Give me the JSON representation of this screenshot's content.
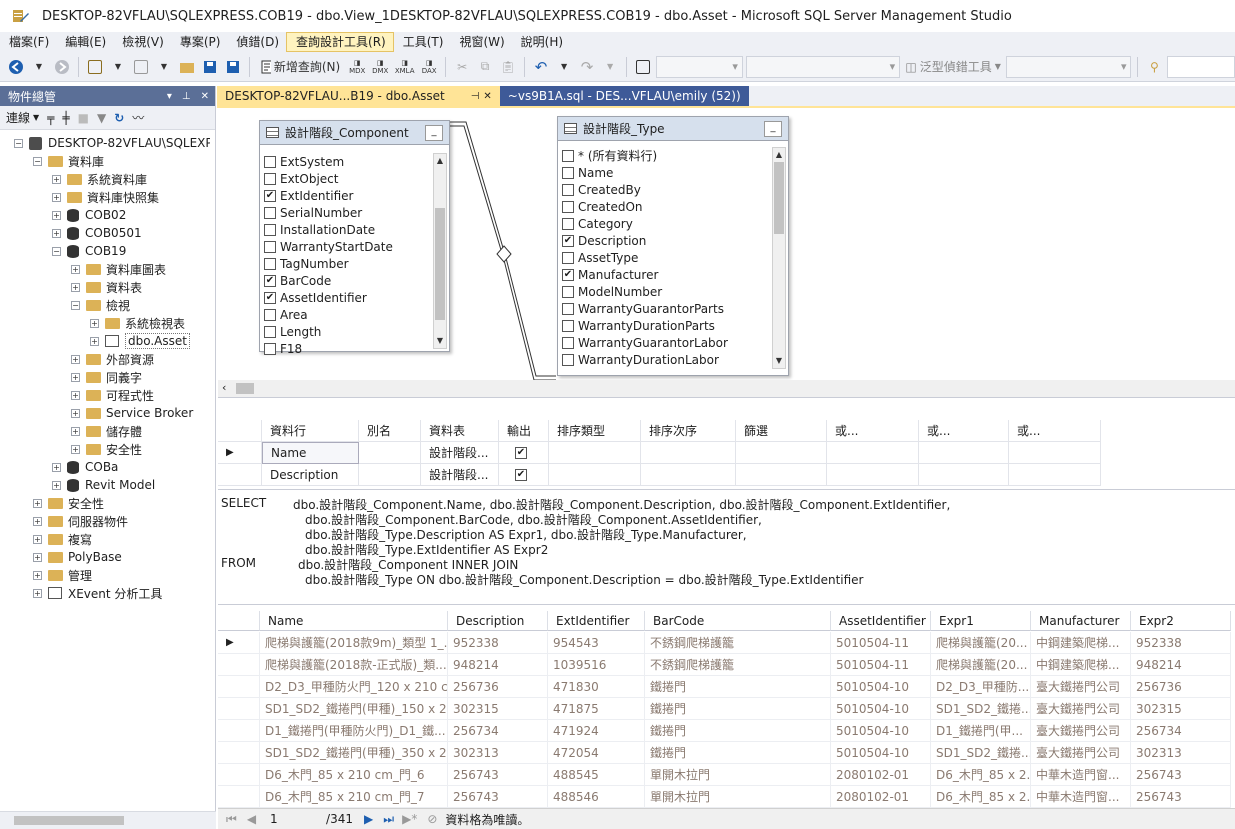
{
  "window": {
    "title": "DESKTOP-82VFLAU\\SQLEXPRESS.COB19 - dbo.View_1DESKTOP-82VFLAU\\SQLEXPRESS.COB19 - dbo.Asset - Microsoft SQL Server Management Studio"
  },
  "menu": [
    "檔案(F)",
    "編輯(E)",
    "檢視(V)",
    "專案(P)",
    "偵錯(D)",
    "查詢設計工具(R)",
    "工具(T)",
    "視窗(W)",
    "說明(H)"
  ],
  "toolbar": {
    "new_query": "新增查詢(N)",
    "mdx": "MDX",
    "dmx": "DMX",
    "xmla": "XMLA",
    "dax": "DAX",
    "generic_debugger": "泛型偵錯工具"
  },
  "object_explorer": {
    "title": "物件總管",
    "connect": "連線",
    "tree": [
      {
        "label": "DESKTOP-82VFLAU\\SQLEXPRESS",
        "type": "server",
        "level": 0,
        "expanded": true
      },
      {
        "label": "資料庫",
        "type": "folder",
        "level": 1,
        "expanded": true
      },
      {
        "label": "系統資料庫",
        "type": "folder",
        "level": 2,
        "expanded": false
      },
      {
        "label": "資料庫快照集",
        "type": "folder",
        "level": 2,
        "expanded": false
      },
      {
        "label": "COB02",
        "type": "db",
        "level": 2,
        "expanded": false
      },
      {
        "label": "COB0501",
        "type": "db",
        "level": 2,
        "expanded": false
      },
      {
        "label": "COB19",
        "type": "db",
        "level": 2,
        "expanded": true
      },
      {
        "label": "資料庫圖表",
        "type": "folder",
        "level": 3,
        "expanded": false
      },
      {
        "label": "資料表",
        "type": "folder",
        "level": 3,
        "expanded": false
      },
      {
        "label": "檢視",
        "type": "folder",
        "level": 3,
        "expanded": true
      },
      {
        "label": "系統檢視表",
        "type": "folder",
        "level": 4,
        "expanded": false
      },
      {
        "label": "dbo.Asset",
        "type": "view",
        "level": 4,
        "expanded": false,
        "selected": true
      },
      {
        "label": "外部資源",
        "type": "folder",
        "level": 3,
        "expanded": false
      },
      {
        "label": "同義字",
        "type": "folder",
        "level": 3,
        "expanded": false
      },
      {
        "label": "可程式性",
        "type": "folder",
        "level": 3,
        "expanded": false
      },
      {
        "label": "Service Broker",
        "type": "folder",
        "level": 3,
        "expanded": false
      },
      {
        "label": "儲存體",
        "type": "folder",
        "level": 3,
        "expanded": false
      },
      {
        "label": "安全性",
        "type": "folder",
        "level": 3,
        "expanded": false
      },
      {
        "label": "COBa",
        "type": "db",
        "level": 2,
        "expanded": false
      },
      {
        "label": "Revit Model",
        "type": "db",
        "level": 2,
        "expanded": false
      },
      {
        "label": "安全性",
        "type": "folder",
        "level": 1,
        "expanded": false
      },
      {
        "label": "伺服器物件",
        "type": "folder",
        "level": 1,
        "expanded": false
      },
      {
        "label": "複寫",
        "type": "folder",
        "level": 1,
        "expanded": false
      },
      {
        "label": "PolyBase",
        "type": "folder",
        "level": 1,
        "expanded": false
      },
      {
        "label": "管理",
        "type": "folder",
        "level": 1,
        "expanded": false
      },
      {
        "label": "XEvent 分析工具",
        "type": "xevent",
        "level": 1,
        "expanded": false
      }
    ]
  },
  "tabs": [
    {
      "label": "DESKTOP-82VFLAU...B19 - dbo.Asset",
      "active": true
    },
    {
      "label": "~vs9B1A.sql - DES...VFLAU\\emily (52))",
      "active": false
    }
  ],
  "diagram": {
    "component": {
      "title": "設計階段_Component",
      "columns": [
        {
          "name": "ExtSystem",
          "checked": false
        },
        {
          "name": "ExtObject",
          "checked": false
        },
        {
          "name": "ExtIdentifier",
          "checked": true
        },
        {
          "name": "SerialNumber",
          "checked": false
        },
        {
          "name": "InstallationDate",
          "checked": false
        },
        {
          "name": "WarrantyStartDate",
          "checked": false
        },
        {
          "name": "TagNumber",
          "checked": false
        },
        {
          "name": "BarCode",
          "checked": true
        },
        {
          "name": "AssetIdentifier",
          "checked": true
        },
        {
          "name": "Area",
          "checked": false
        },
        {
          "name": "Length",
          "checked": false
        },
        {
          "name": "F18",
          "checked": false
        }
      ]
    },
    "type": {
      "title": "設計階段_Type",
      "columns": [
        {
          "name": "* (所有資料行)",
          "checked": false
        },
        {
          "name": "Name",
          "checked": false
        },
        {
          "name": "CreatedBy",
          "checked": false
        },
        {
          "name": "CreatedOn",
          "checked": false
        },
        {
          "name": "Category",
          "checked": false
        },
        {
          "name": "Description",
          "checked": true
        },
        {
          "name": "AssetType",
          "checked": false
        },
        {
          "name": "Manufacturer",
          "checked": true
        },
        {
          "name": "ModelNumber",
          "checked": false
        },
        {
          "name": "WarrantyGuarantorParts",
          "checked": false
        },
        {
          "name": "WarrantyDurationParts",
          "checked": false
        },
        {
          "name": "WarrantyGuarantorLabor",
          "checked": false
        },
        {
          "name": "WarrantyDurationLabor",
          "checked": false
        }
      ]
    }
  },
  "criteria": {
    "headers": [
      "資料行",
      "別名",
      "資料表",
      "輸出",
      "排序類型",
      "排序次序",
      "篩選",
      "或...",
      "或...",
      "或..."
    ],
    "rows": [
      {
        "column": "Name",
        "table": "設計階段...",
        "output": true
      },
      {
        "column": "Description",
        "table": "設計階段...",
        "output": true
      }
    ]
  },
  "sql": [
    {
      "kw": "SELECT",
      "text": "dbo.設計階段_Component.Name, dbo.設計階段_Component.Description, dbo.設計階段_Component.ExtIdentifier,"
    },
    {
      "kw": "",
      "text": "dbo.設計階段_Component.BarCode, dbo.設計階段_Component.AssetIdentifier,"
    },
    {
      "kw": "",
      "text": "dbo.設計階段_Type.Description AS Expr1, dbo.設計階段_Type.Manufacturer,"
    },
    {
      "kw": "",
      "text": "dbo.設計階段_Type.ExtIdentifier AS Expr2"
    },
    {
      "kw": "FROM",
      "text": "dbo.設計階段_Component INNER JOIN"
    },
    {
      "kw": "",
      "text": "dbo.設計階段_Type ON dbo.設計階段_Component.Description = dbo.設計階段_Type.ExtIdentifier"
    }
  ],
  "results": {
    "headers": [
      "Name",
      "Description",
      "ExtIdentifier",
      "BarCode",
      "AssetIdentifier",
      "Expr1",
      "Manufacturer",
      "Expr2"
    ],
    "rows": [
      [
        "爬梯與護籠(2018款9m)_類型 1_...",
        "952338",
        "954543",
        "不銹鋼爬梯護籠",
        "5010504-11",
        "爬梯與護籠(20...",
        "中鋼建築爬梯...",
        "952338"
      ],
      [
        "爬梯與護籠(2018款-正式版)_類...",
        "948214",
        "1039516",
        "不銹鋼爬梯護籠",
        "5010504-11",
        "爬梯與護籠(20...",
        "中鋼建築爬梯...",
        "948214"
      ],
      [
        "D2_D3_甲種防火門_120 x 210 c...",
        "256736",
        "471830",
        "鐵捲門",
        "5010504-10",
        "D2_D3_甲種防...",
        "臺大鐵捲門公司",
        "256736"
      ],
      [
        "SD1_SD2_鐵捲門(甲種)_150 x 2...",
        "302315",
        "471875",
        "鐵捲門",
        "5010504-10",
        "SD1_SD2_鐵捲...",
        "臺大鐵捲門公司",
        "302315"
      ],
      [
        "D1_鐵捲門(甲種防火門)_D1_鐵...",
        "256734",
        "471924",
        "鐵捲門",
        "5010504-10",
        "D1_鐵捲門(甲...",
        "臺大鐵捲門公司",
        "256734"
      ],
      [
        "SD1_SD2_鐵捲門(甲種)_350 x 2...",
        "302313",
        "472054",
        "鐵捲門",
        "5010504-10",
        "SD1_SD2_鐵捲...",
        "臺大鐵捲門公司",
        "302313"
      ],
      [
        "D6_木門_85 x 210 cm_門_6",
        "256743",
        "488545",
        "單開木拉門",
        "2080102-01",
        "D6_木門_85 x 2...",
        "中華木造門窗...",
        "256743"
      ],
      [
        "D6_木門_85 x 210 cm_門_7",
        "256743",
        "488546",
        "單開木拉門",
        "2080102-01",
        "D6_木門_85 x 2...",
        "中華木造門窗...",
        "256743"
      ]
    ]
  },
  "nav": {
    "current": "1",
    "total": "/341",
    "status": "資料格為唯讀。"
  },
  "colors": {
    "accent_tab": "#ffe497",
    "panel_header": "#5b6f97",
    "inactive_tab": "#3e5a98"
  }
}
